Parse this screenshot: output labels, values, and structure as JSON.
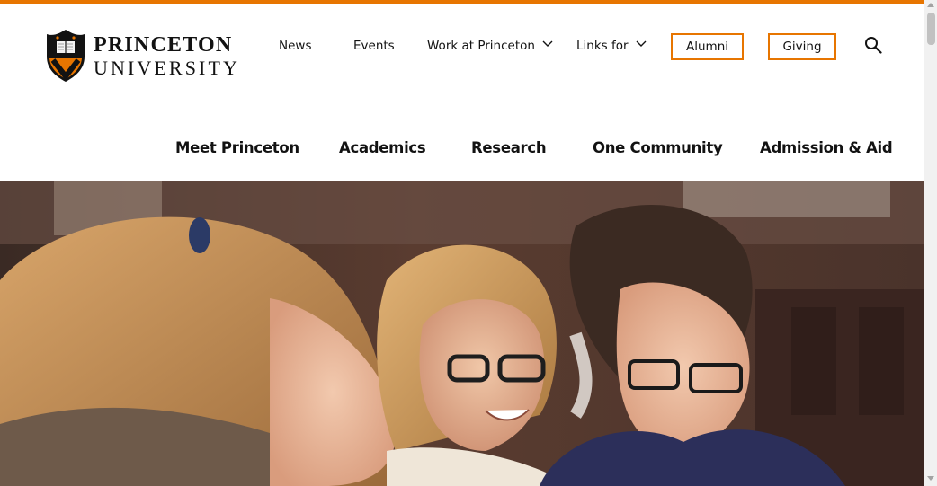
{
  "logo": {
    "line1": "PRINCETON",
    "line2": "UNIVERSITY",
    "shield_icon": "princeton-shield-icon"
  },
  "util_nav": {
    "items": [
      {
        "label": "News"
      },
      {
        "label": "Events"
      },
      {
        "label": "Work at Princeton",
        "dropdown": true
      },
      {
        "label": "Links for",
        "dropdown": true
      }
    ],
    "buttons": [
      {
        "label": "Alumni"
      },
      {
        "label": "Giving"
      }
    ],
    "search_icon": "search-icon"
  },
  "main_nav": {
    "items": [
      {
        "label": "Meet Princeton"
      },
      {
        "label": "Academics"
      },
      {
        "label": "Research"
      },
      {
        "label": "One Community"
      },
      {
        "label": "Admission & Aid"
      }
    ]
  },
  "colors": {
    "accent": "#e77500",
    "text": "#121212"
  }
}
